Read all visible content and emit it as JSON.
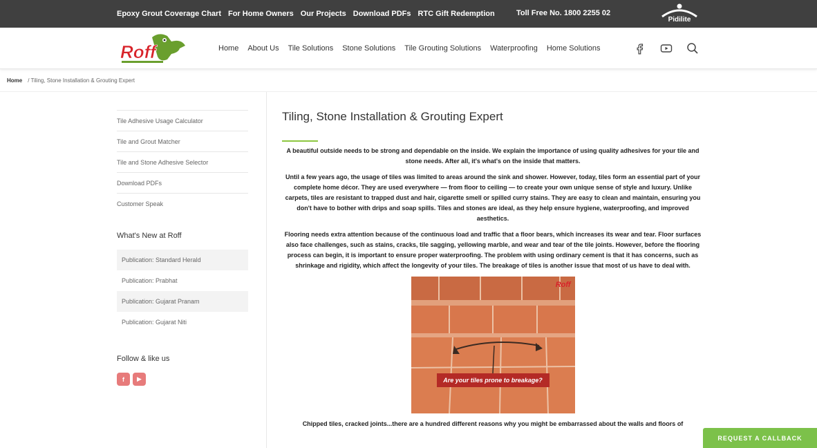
{
  "topbar": {
    "links": [
      "Epoxy Grout Coverage Chart",
      "For Home Owners",
      "Our Projects",
      "Download PDFs",
      "RTC Gift Redemption"
    ],
    "toll_free": "Toll Free No. 1800 2255 02",
    "pidilite_label": "Pidilite"
  },
  "nav": {
    "logo_text": "Roff",
    "menu": [
      "Home",
      "About Us",
      "Tile Solutions",
      "Stone Solutions",
      "Tile Grouting Solutions",
      "Waterproofing",
      "Home Solutions"
    ],
    "icons": [
      "facebook-icon",
      "youtube-icon",
      "search-icon"
    ]
  },
  "breadcrumb": {
    "home": "Home",
    "current": "/  Tiling, Stone Installation & Grouting Expert"
  },
  "sidebar": {
    "links": [
      "Tile Adhesive Usage Calculator",
      "Tile and Grout Matcher",
      "Tile and Stone Adhesive Selector",
      "Download PDFs",
      "Customer Speak"
    ],
    "whats_new_heading": "What's New at Roff",
    "publications": [
      "Publication: Standard Herald",
      "Publication: Prabhat",
      "Publication: Gujarat Pranam",
      "Publication: Gujarat Niti"
    ],
    "follow_heading": "Follow & like us",
    "social": [
      {
        "icon": "facebook-icon",
        "glyph": "f"
      },
      {
        "icon": "youtube-icon",
        "glyph": "▶"
      }
    ]
  },
  "content": {
    "title": "Tiling, Stone Installation & Grouting Expert",
    "paragraphs": [
      "A beautiful outside needs to be strong and dependable on the inside. We explain the importance of using quality adhesives for your tile and stone needs. After all, it's what's on the inside that matters.",
      "Until a few years ago, the usage of tiles was limited to areas around the sink and shower. However, today, tiles form an essential part of your complete home décor. They are used everywhere — from floor to ceiling — to create your own unique sense of style and luxury. Unlike carpets, tiles are resistant to trapped dust and hair, cigarette smell or spilled curry stains. They are easy to clean and maintain, ensuring you don't have to bother with drips and soap spills. Tiles and stones are ideal, as they help ensure hygiene, waterproofing, and improved aesthetics.",
      "Flooring needs extra attention because of the continuous load and traffic that a floor bears, which increases its wear and tear. Floor surfaces also face challenges, such as stains, cracks, tile sagging, yellowing marble, and wear and tear of the tile joints. However, before the flooring process can begin, it is important to ensure proper waterproofing. The problem with using ordinary cement is that it has concerns, such as shrinkage and rigidity, which affect the longevity of your tiles. The breakage of tiles is another issue that most of us have to deal with."
    ],
    "image_caption": "Are your tiles prone to breakage?",
    "image_logo": "Roff",
    "last_line": "Chipped tiles, cracked joints...there are a hundred different reasons why you might be embarrassed about the walls and floors of"
  },
  "callback_label": "REQUEST A CALLBACK"
}
